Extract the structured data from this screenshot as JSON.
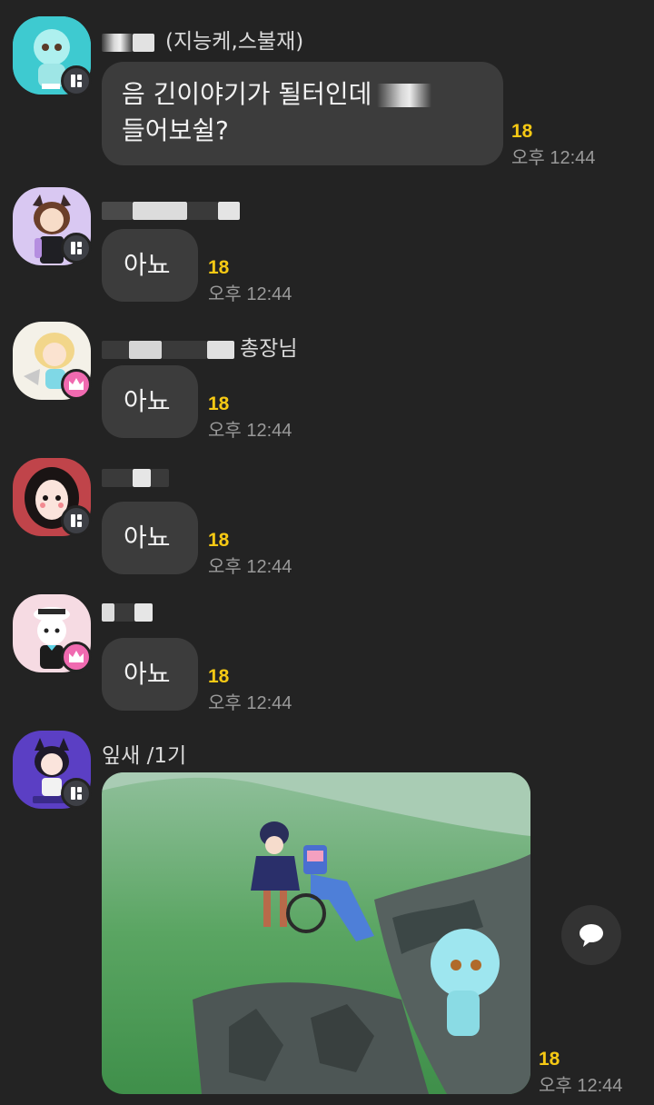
{
  "messages": [
    {
      "sender_suffix": "(지능케,스불재)",
      "text_line1": "음 긴이야기가 될터인데",
      "text_line2": "들어보쉴?",
      "unread": "18",
      "time": "오후 12:44",
      "badge": "manager-badge-icon"
    },
    {
      "text": "아뇨",
      "unread": "18",
      "time": "오후 12:44",
      "badge": "manager-badge-icon"
    },
    {
      "sender_suffix": "총장님",
      "text": "아뇨",
      "unread": "18",
      "time": "오후 12:44",
      "badge": "crown-badge-icon"
    },
    {
      "text": "아뇨",
      "unread": "18",
      "time": "오후 12:44",
      "badge": "manager-badge-icon"
    },
    {
      "text": "아뇨",
      "unread": "18",
      "time": "오후 12:44",
      "badge": "crown-badge-icon"
    },
    {
      "sender": "잎새 /1기",
      "attachment": "photo",
      "unread": "18",
      "time": "오후 12:44",
      "badge": "manager-badge-icon"
    }
  ],
  "actions": {
    "comment_icon": "speech-bubble-icon"
  },
  "colors": {
    "background": "#232323",
    "bubble": "#3c3c3c",
    "unread": "#f6c914",
    "time": "#9a9a9a",
    "owner_badge": "#f06ab0"
  }
}
